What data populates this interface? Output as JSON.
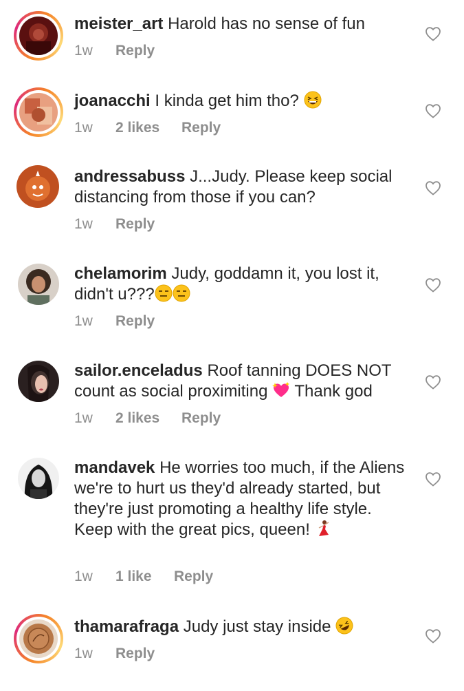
{
  "comments": [
    {
      "username": "meister_art",
      "text": "Harold has no sense of fun",
      "time": "1w",
      "likes": "",
      "reply": "Reply"
    },
    {
      "username": "joanacchi",
      "text": "I kinda get him tho?",
      "time": "1w",
      "likes": "2 likes",
      "reply": "Reply"
    },
    {
      "username": "andressabuss",
      "text": "J...Judy. Please keep social distancing from those if you can?",
      "time": "1w",
      "likes": "",
      "reply": "Reply"
    },
    {
      "username": "chelamorim",
      "text": "Judy, goddamn it, you lost it, didn't u???",
      "time": "1w",
      "likes": "",
      "reply": "Reply"
    },
    {
      "username": "sailor.enceladus",
      "text": "Roof tanning DOES NOT count as social proximiting",
      "text2": "Thank god",
      "time": "1w",
      "likes": "2 likes",
      "reply": "Reply"
    },
    {
      "username": "mandavek",
      "text": "He worries too much, if the Aliens we're to hurt us they'd already started, but they're just promoting a healthy life style. Keep with the great pics, queen!",
      "time": "1w",
      "likes": "1 like",
      "reply": "Reply"
    },
    {
      "username": "thamarafraga",
      "text": "Judy just stay inside",
      "time": "1w",
      "likes": "",
      "reply": "Reply"
    }
  ],
  "icons": {
    "like": "heart-outline-icon",
    "emoji_laugh": "grinning-squinting-face-icon",
    "emoji_expressionless": "expressionless-face-icon",
    "emoji_heart": "sparkling-heart-icon",
    "emoji_dancer": "dancer-icon",
    "emoji_rofl": "rolling-on-floor-laughing-icon"
  },
  "colors": {
    "text": "#262626",
    "meta": "#8e8e8e",
    "story_ring_start": "#f58529",
    "story_ring_end": "#dd2a7b"
  }
}
